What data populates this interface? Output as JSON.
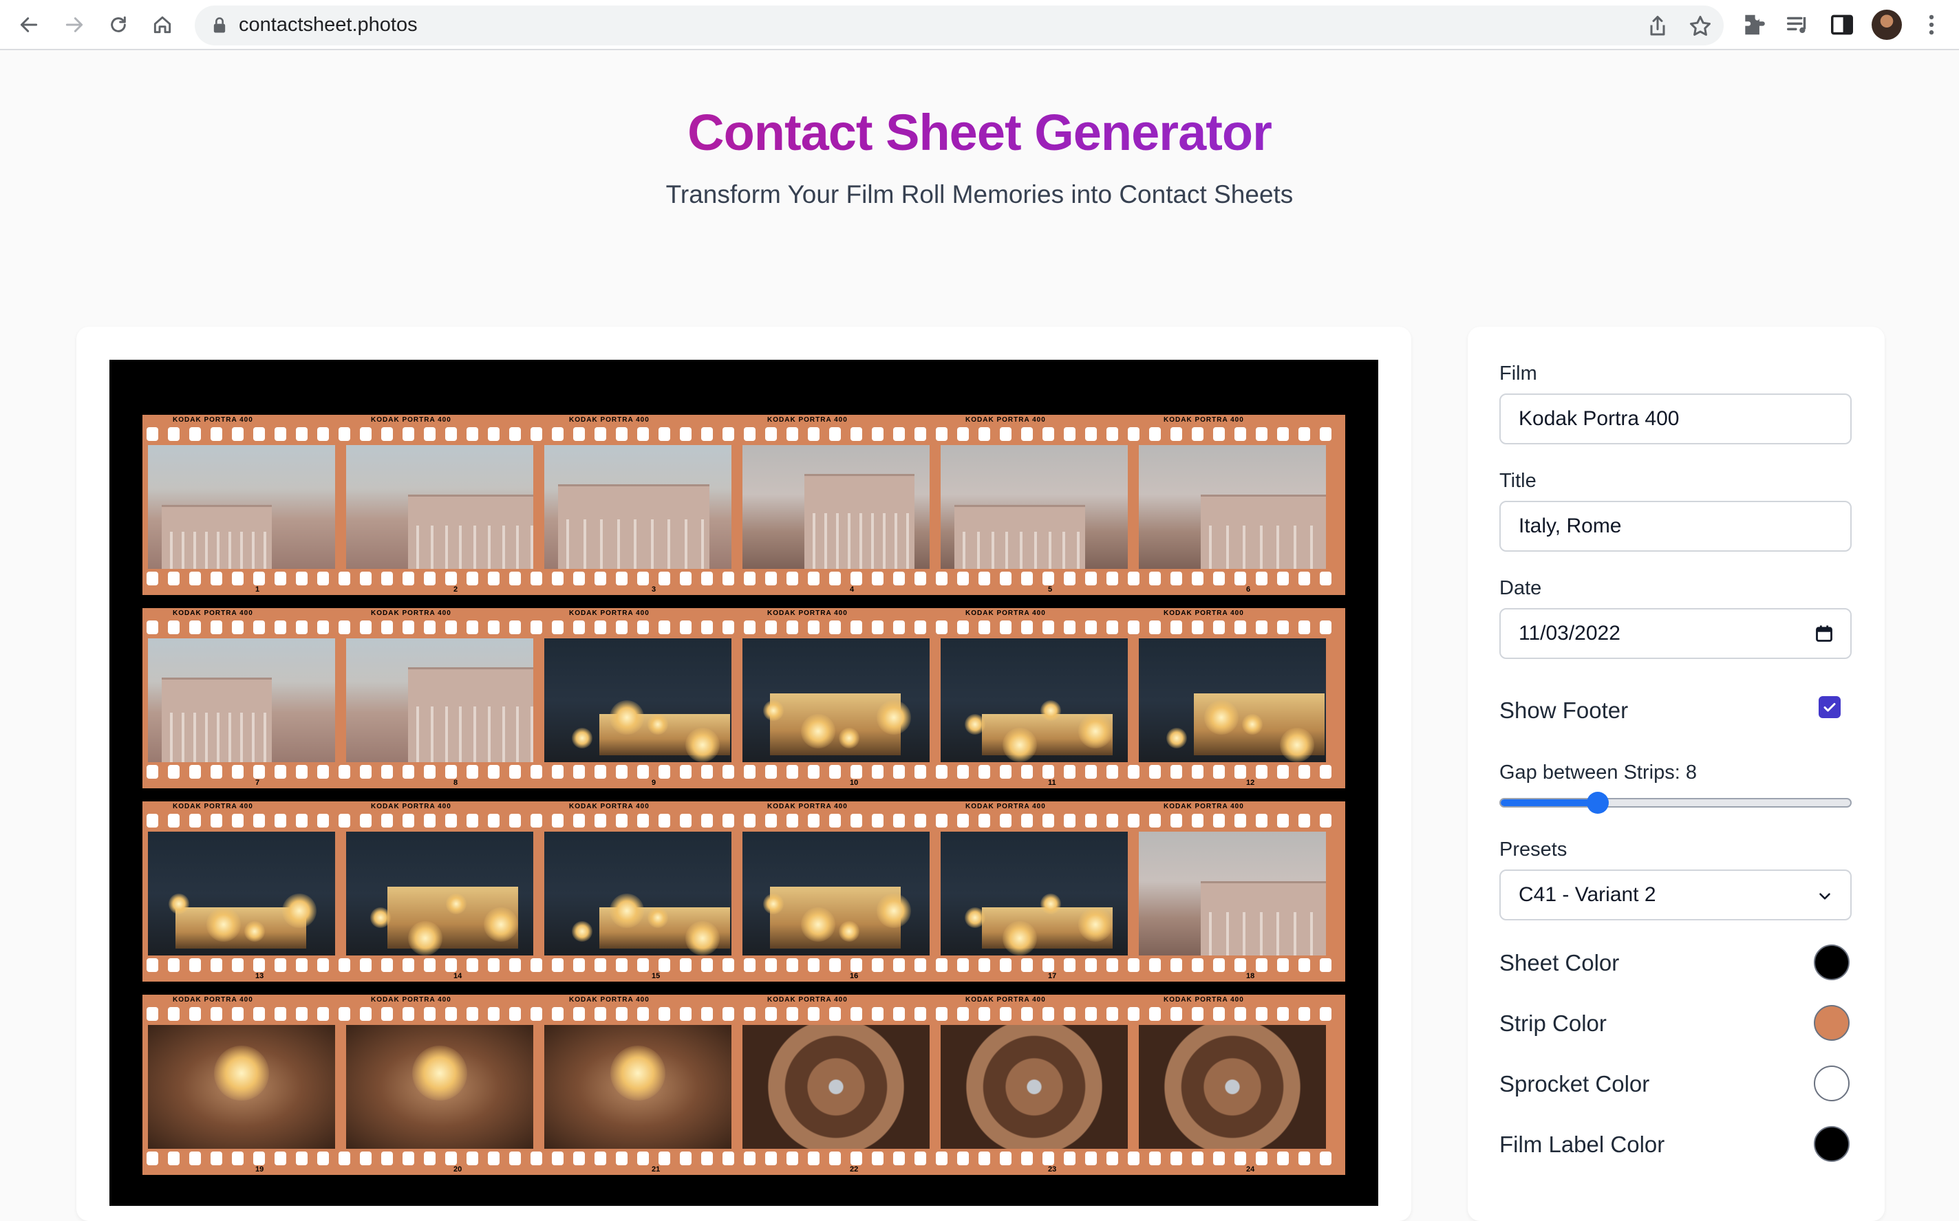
{
  "browser": {
    "url": "contactsheet.photos"
  },
  "header": {
    "title": "Contact Sheet Generator",
    "subtitle": "Transform Your Film Roll Memories into Contact Sheets"
  },
  "sheet": {
    "strip_label": "KODAK PORTRA 400",
    "frame_numbers": [
      "1",
      "2",
      "3",
      "4",
      "5",
      "6",
      "7",
      "8",
      "9",
      "10",
      "11",
      "12",
      "13",
      "14",
      "15",
      "16",
      "17",
      "18",
      "19",
      "20",
      "21",
      "22",
      "23",
      "24"
    ]
  },
  "settings": {
    "film_label": "Film",
    "film_value": "Kodak Portra 400",
    "title_label": "Title",
    "title_value": "Italy, Rome",
    "date_label": "Date",
    "date_value": "11/03/2022",
    "show_footer_label": "Show Footer",
    "show_footer_checked": true,
    "gap_label": "Gap between Strips: 8",
    "gap_value": 8,
    "gap_fraction": 0.28,
    "presets_label": "Presets",
    "presets_value": "C41 - Variant 2",
    "sheet_color_label": "Sheet Color",
    "sheet_color": "#000000",
    "strip_color_label": "Strip Color",
    "strip_color": "#d4845a",
    "sprocket_color_label": "Sprocket Color",
    "sprocket_color": "#ffffff",
    "film_label_color_label": "Film Label Color",
    "film_label_color": "#000000"
  },
  "colors": {
    "accent": "#4338ca",
    "slider": "#1d6ff2",
    "title_gradient_start": "#db2777",
    "title_gradient_end": "#7c3aed"
  },
  "icons": {
    "back": "arrow-left-icon",
    "forward": "arrow-right-icon",
    "reload": "reload-icon",
    "home": "home-icon",
    "lock": "lock-icon",
    "share": "share-icon",
    "bookmark": "star-icon",
    "extensions": "puzzle-icon",
    "media": "media-queue-icon",
    "side_panel": "side-panel-icon",
    "menu": "kebab-menu-icon"
  }
}
